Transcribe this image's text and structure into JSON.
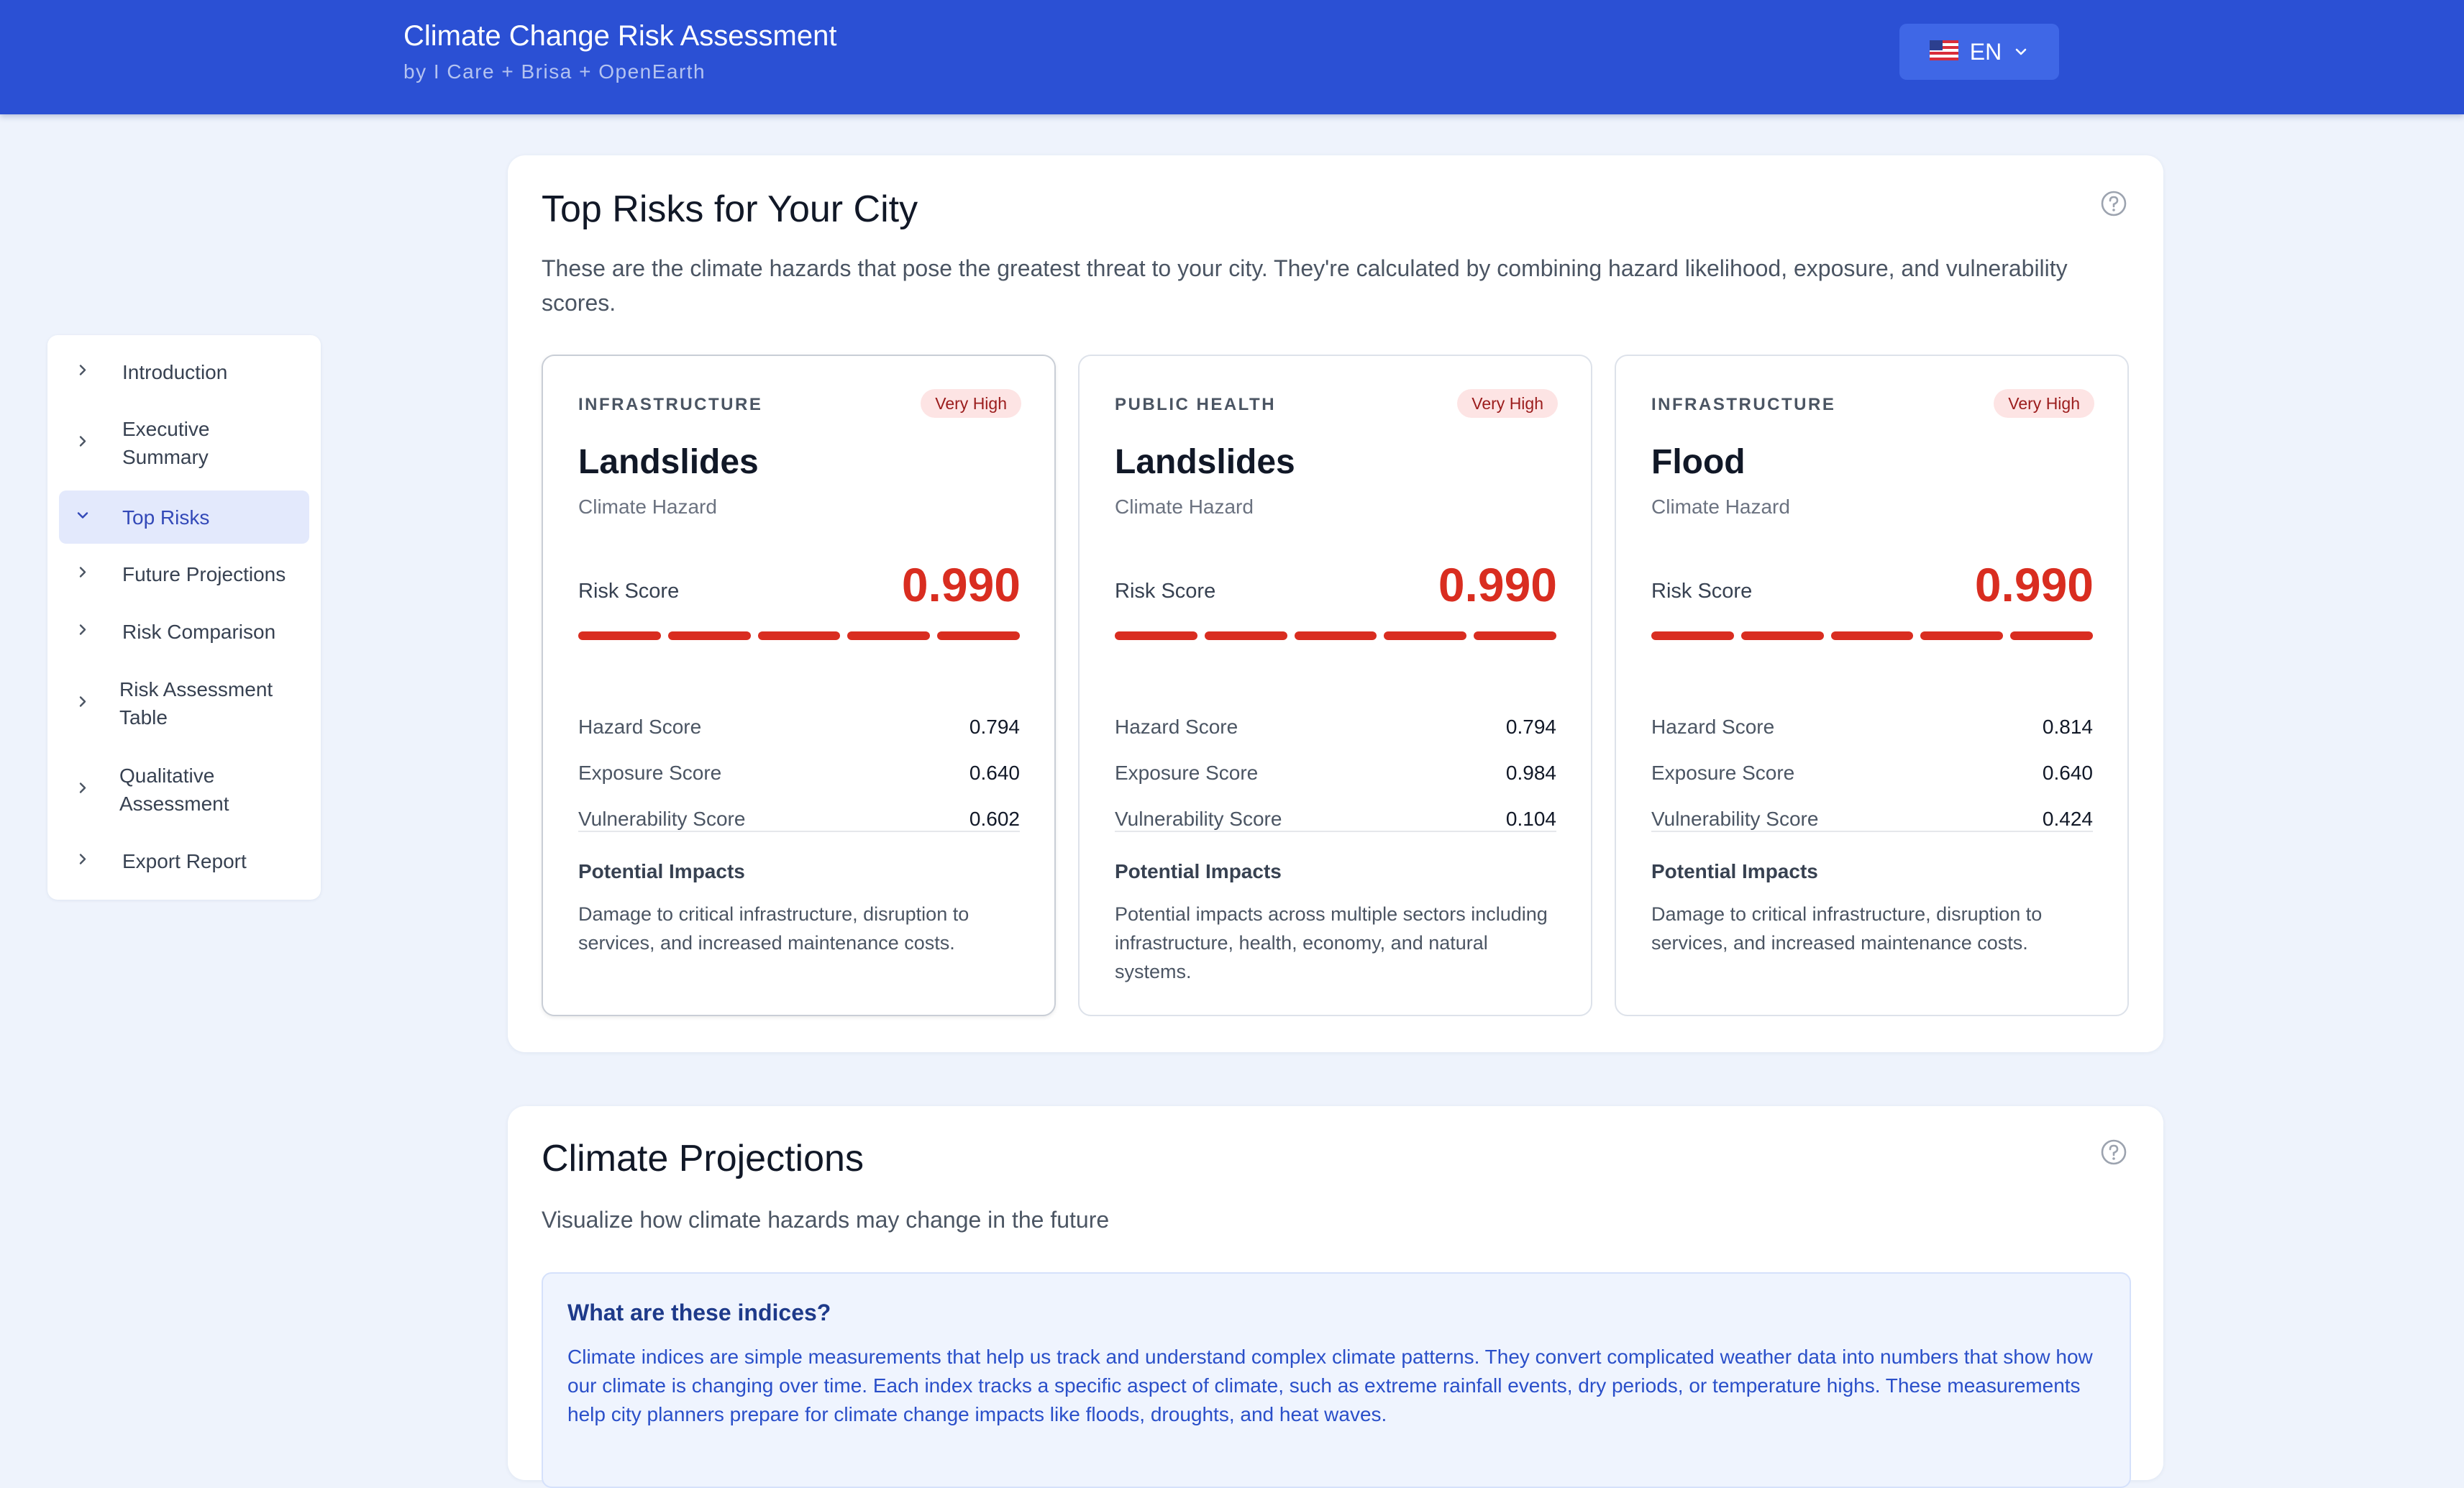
{
  "header": {
    "title": "Climate Change Risk Assessment",
    "subtitle": "by I Care + Brisa + OpenEarth",
    "language": {
      "label": "EN",
      "flag_icon": "us-flag-icon"
    }
  },
  "sidebar": {
    "items": [
      {
        "label": "Introduction",
        "active": false
      },
      {
        "label": "Executive Summary",
        "active": false
      },
      {
        "label": "Top Risks",
        "active": true
      },
      {
        "label": "Future Projections",
        "active": false
      },
      {
        "label": "Risk Comparison",
        "active": false
      },
      {
        "label": "Risk Assessment Table",
        "active": false
      },
      {
        "label": "Qualitative Assessment",
        "active": false
      },
      {
        "label": "Export Report",
        "active": false
      }
    ]
  },
  "top_risks": {
    "title": "Top Risks for Your City",
    "description": "These are the climate hazards that pose the greatest threat to your city. They're calculated by combining hazard likelihood, exposure, and vulnerability scores.",
    "help_icon": "question-circle-icon",
    "cards": [
      {
        "category": "INFRASTRUCTURE",
        "badge": "Very High",
        "name": "Landslides",
        "type": "Climate Hazard",
        "risk_score_label": "Risk Score",
        "risk_score": "0.990",
        "risk_level_segments": 5,
        "metrics": [
          {
            "label": "Hazard Score",
            "value": "0.794"
          },
          {
            "label": "Exposure Score",
            "value": "0.640"
          },
          {
            "label": "Vulnerability Score",
            "value": "0.602"
          }
        ],
        "impacts_title": "Potential Impacts",
        "impacts_text": "Damage to critical infrastructure, disruption to services, and increased maintenance costs."
      },
      {
        "category": "PUBLIC HEALTH",
        "badge": "Very High",
        "name": "Landslides",
        "type": "Climate Hazard",
        "risk_score_label": "Risk Score",
        "risk_score": "0.990",
        "risk_level_segments": 5,
        "metrics": [
          {
            "label": "Hazard Score",
            "value": "0.794"
          },
          {
            "label": "Exposure Score",
            "value": "0.984"
          },
          {
            "label": "Vulnerability Score",
            "value": "0.104"
          }
        ],
        "impacts_title": "Potential Impacts",
        "impacts_text": "Potential impacts across multiple sectors including infrastructure, health, economy, and natural systems."
      },
      {
        "category": "INFRASTRUCTURE",
        "badge": "Very High",
        "name": "Flood",
        "type": "Climate Hazard",
        "risk_score_label": "Risk Score",
        "risk_score": "0.990",
        "risk_level_segments": 5,
        "metrics": [
          {
            "label": "Hazard Score",
            "value": "0.814"
          },
          {
            "label": "Exposure Score",
            "value": "0.640"
          },
          {
            "label": "Vulnerability Score",
            "value": "0.424"
          }
        ],
        "impacts_title": "Potential Impacts",
        "impacts_text": "Damage to critical infrastructure, disruption to services, and increased maintenance costs."
      }
    ]
  },
  "climate_projections": {
    "title": "Climate Projections",
    "description": "Visualize how climate hazards may change in the future",
    "help_icon": "question-circle-icon",
    "info": {
      "title": "What are these indices?",
      "text": "Climate indices are simple measurements that help us track and understand complex climate patterns. They convert complicated weather data into numbers that show how our climate is changing over time. Each index tracks a specific aspect of climate, such as extreme rainfall events, dry periods, or temperature highs. These measurements help city planners prepare for climate change impacts like floods, droughts, and heat waves."
    }
  },
  "colors": {
    "header_bg": "#2b50d4",
    "page_bg": "#eef3fc",
    "risk_red": "#d92d20",
    "badge_bg": "#fde4e4",
    "active_nav_bg": "#e3e9fc"
  }
}
